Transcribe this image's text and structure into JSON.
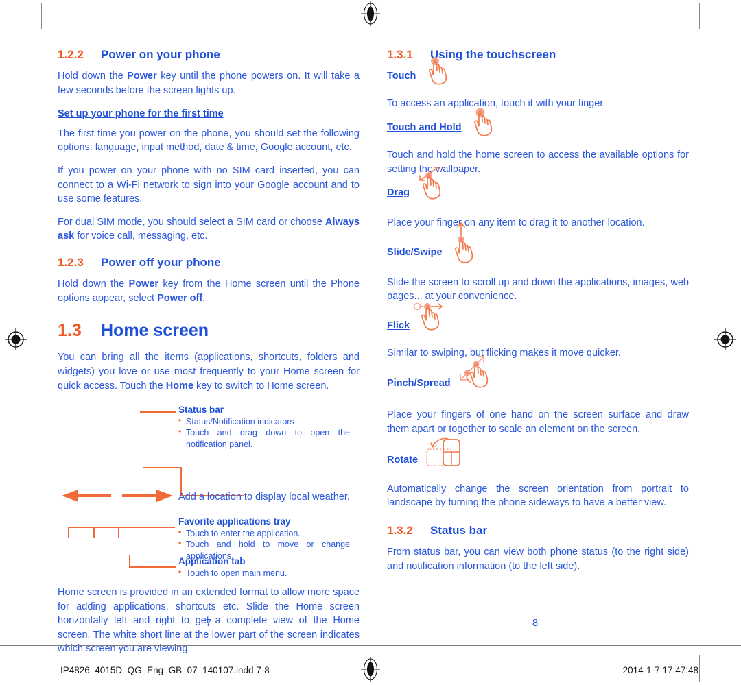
{
  "colors": {
    "accent_orange": "#ef5a23",
    "heading_blue": "#1d4fd8",
    "body_blue": "#2b57db",
    "rule_orange": "#f2693a",
    "icon_orange": "#f08050",
    "icon_pink": "#f7a893"
  },
  "left_page": {
    "page_number": "7",
    "sections": [
      {
        "number": "1.2.2",
        "title": "Power on your phone"
      },
      {
        "number": "1.2.3",
        "title": "Power off your phone"
      },
      {
        "number": "1.3",
        "title": "Home screen"
      }
    ],
    "para_power_on": "Hold down the <b>Power</b> key until the phone powers on. It will take a few seconds before the screen lights up.",
    "lead_in_setup": "Set up your phone for the first time",
    "para_first_time": "The first time you power on the phone, you should set the following options: language, input method, date &amp; time, Google account, etc.",
    "para_no_sim": "If you power on your phone with no SIM card inserted, you can connect to a Wi-Fi network to sign into your Google account and to use some features.",
    "para_dual_sim": "For dual SIM mode, you should select a SIM card or choose <b>Always ask</b> for voice call, messaging, etc.",
    "para_power_off": "Hold down the <b>Power</b> key from the Home screen until the Phone options appear, select <b>Power off</b>.",
    "para_home_intro": "You can bring all the items (applications, shortcuts, folders and widgets) you love or use most frequently to your Home screen for quick access. Touch the <b>Home</b> key to switch to Home screen.",
    "para_home_extended": "Home screen is provided in an extended format to allow more space for adding applications, shortcuts etc. Slide the Home screen horizontally left and right to get a complete view of the Home screen. The white short line at the lower part of the screen indicates which screen you are viewing.",
    "callouts": [
      {
        "title": "Status bar",
        "items": [
          "Status/Notification indicators",
          "Touch and drag down to open the notification panel."
        ]
      },
      {
        "plain": "Add a location to display local weather."
      },
      {
        "title": "Favorite applications tray",
        "items": [
          "Touch to enter the application.",
          "Touch and hold to move or change applications."
        ]
      },
      {
        "title": "Application tab",
        "items": [
          "Touch to open main menu."
        ]
      }
    ]
  },
  "right_page": {
    "page_number": "8",
    "sections": [
      {
        "number": "1.3.1",
        "title": "Using the touchscreen"
      },
      {
        "number": "1.3.2",
        "title": "Status bar"
      }
    ],
    "gestures": [
      {
        "term": "Touch",
        "icon": "touch-hand-icon",
        "description": "To access an application, touch it with your finger."
      },
      {
        "term": "Touch and Hold",
        "icon": "touch-hold-hand-icon",
        "description": "Touch and hold the home screen to access the available options for setting the wallpaper."
      },
      {
        "term": "Drag",
        "icon": "drag-hand-icon",
        "description": "Place your finger on any item to drag it to another location."
      },
      {
        "term": "Slide/Swipe",
        "icon": "slide-hand-icon",
        "description": "Slide the screen to scroll up and down the applications, images, web pages... at your convenience."
      },
      {
        "term": "Flick",
        "icon": "flick-hand-icon",
        "description": "Similar to swiping, but flicking makes it move quicker."
      },
      {
        "term": "Pinch/Spread",
        "icon": "pinch-spread-hand-icon",
        "description": "Place your fingers of one hand on the screen surface and draw them apart or together to scale an element on the screen."
      },
      {
        "term": "Rotate",
        "icon": "rotate-phone-icon",
        "description": "Automatically change the screen orientation from portrait to landscape by turning the phone sideways to have a better view."
      }
    ],
    "para_status_bar": "From status bar, you can view both phone status (to the right side) and notification information (to the left side)."
  },
  "footer": {
    "file_name": "IP4826_4015D_QG_Eng_GB_07_140107.indd   7-8",
    "timestamp": "2014-1-7   17:47:48"
  }
}
